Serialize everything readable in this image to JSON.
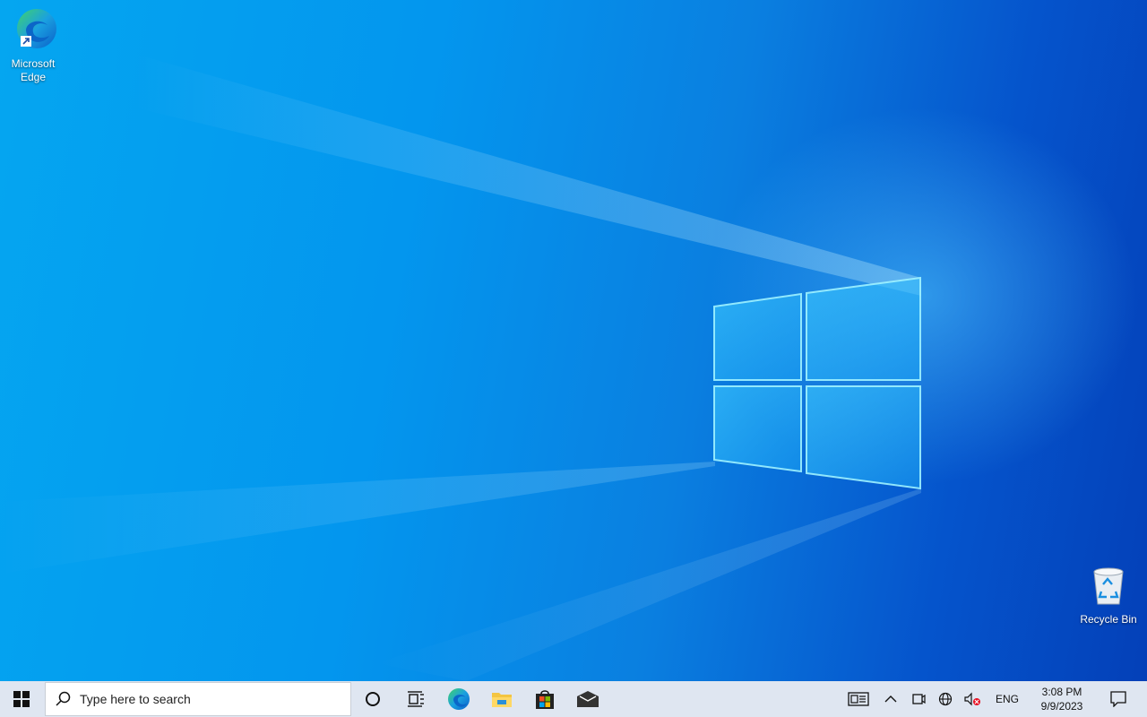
{
  "desktop": {
    "icons": [
      {
        "label": "Microsoft Edge",
        "icon": "edge-icon"
      },
      {
        "label": "Recycle Bin",
        "icon": "recycle-bin-icon"
      }
    ]
  },
  "taskbar": {
    "start_icon": "windows-logo-icon",
    "search": {
      "placeholder": "Type here to search",
      "icon": "search-icon"
    },
    "pinned": [
      {
        "icon": "cortana-icon"
      },
      {
        "icon": "task-view-icon"
      },
      {
        "icon": "edge-icon"
      },
      {
        "icon": "file-explorer-icon"
      },
      {
        "icon": "microsoft-store-icon"
      },
      {
        "icon": "mail-icon"
      }
    ],
    "tray": {
      "language": "ENG",
      "time": "3:08 PM",
      "date": "9/9/2023",
      "icons": [
        "news-icon",
        "chevron-up-icon",
        "meet-now-icon",
        "network-icon",
        "volume-muted-icon",
        "action-center-icon"
      ]
    }
  },
  "colors": {
    "taskbar_bg": "#dfe6f1",
    "wallpaper_light": "#05a6f0",
    "wallpaper_dark": "#0440b8"
  }
}
